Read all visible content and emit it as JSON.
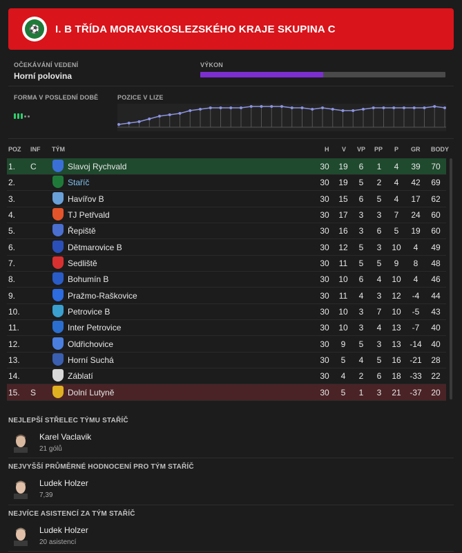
{
  "header": {
    "title": "I. B TŘÍDA MORAVSKOSLEZSKÉHO KRAJE SKUPINA C",
    "accent": "#d9141b"
  },
  "expectation": {
    "label": "Očekávání vedení",
    "value": "Horní polovina"
  },
  "performance": {
    "label": "Výkon",
    "level": 0.5,
    "color": "#7c2fd0"
  },
  "form": {
    "label": "Forma v poslední době",
    "bars": 3,
    "dots": 2,
    "color": "#2fcf6e"
  },
  "position_chart": {
    "label": "Pozice v lize",
    "chart_data": {
      "type": "line",
      "ylim": [
        15,
        1
      ],
      "values": [
        15,
        14,
        13,
        11,
        9,
        8,
        7,
        5,
        4,
        3,
        3,
        3,
        3,
        2,
        2,
        2,
        2,
        3,
        3,
        4,
        3,
        4,
        5,
        5,
        4,
        3,
        3,
        3,
        3,
        3,
        3,
        2,
        3
      ]
    }
  },
  "table": {
    "headers": {
      "pos": "POZ",
      "inf": "INF",
      "team": "TÝM",
      "h": "H",
      "v": "V",
      "vp": "VP",
      "pp": "PP",
      "p": "P",
      "gr": "GR",
      "body": "BODY"
    },
    "rows": [
      {
        "pos": "1.",
        "inf": "C",
        "team": "Slavoj Rychvald",
        "h": "30",
        "v": "19",
        "vp": "6",
        "pp": "1",
        "p": "4",
        "gr": "39",
        "body": "70",
        "color": "#3a6fd8",
        "status": "promo"
      },
      {
        "pos": "2.",
        "inf": "",
        "team": "Staříč",
        "h": "30",
        "v": "19",
        "vp": "5",
        "pp": "2",
        "p": "4",
        "gr": "42",
        "body": "69",
        "color": "#1f7a3a",
        "status": "self"
      },
      {
        "pos": "3.",
        "inf": "",
        "team": "Havířov B",
        "h": "30",
        "v": "15",
        "vp": "6",
        "pp": "5",
        "p": "4",
        "gr": "17",
        "body": "62",
        "color": "#6aa0d8",
        "status": ""
      },
      {
        "pos": "4.",
        "inf": "",
        "team": "TJ Petřvald",
        "h": "30",
        "v": "17",
        "vp": "3",
        "pp": "3",
        "p": "7",
        "gr": "24",
        "body": "60",
        "color": "#e3542a",
        "status": ""
      },
      {
        "pos": "5.",
        "inf": "",
        "team": "Řepiště",
        "h": "30",
        "v": "16",
        "vp": "3",
        "pp": "6",
        "p": "5",
        "gr": "19",
        "body": "60",
        "color": "#4a6fd0",
        "status": ""
      },
      {
        "pos": "6.",
        "inf": "",
        "team": "Dětmarovice B",
        "h": "30",
        "v": "12",
        "vp": "5",
        "pp": "3",
        "p": "10",
        "gr": "4",
        "body": "49",
        "color": "#2b4fb8",
        "status": ""
      },
      {
        "pos": "7.",
        "inf": "",
        "team": "Sedliště",
        "h": "30",
        "v": "11",
        "vp": "5",
        "pp": "5",
        "p": "9",
        "gr": "8",
        "body": "48",
        "color": "#d83030",
        "status": ""
      },
      {
        "pos": "8.",
        "inf": "",
        "team": "Bohumín B",
        "h": "30",
        "v": "10",
        "vp": "6",
        "pp": "4",
        "p": "10",
        "gr": "4",
        "body": "46",
        "color": "#2a5cc8",
        "status": ""
      },
      {
        "pos": "9.",
        "inf": "",
        "team": "Pražmo-Raškovice",
        "h": "30",
        "v": "11",
        "vp": "4",
        "pp": "3",
        "p": "12",
        "gr": "-4",
        "body": "44",
        "color": "#2c6be0",
        "status": ""
      },
      {
        "pos": "10.",
        "inf": "",
        "team": "Petrovice B",
        "h": "30",
        "v": "10",
        "vp": "3",
        "pp": "7",
        "p": "10",
        "gr": "-5",
        "body": "43",
        "color": "#3aa0d0",
        "status": ""
      },
      {
        "pos": "11.",
        "inf": "",
        "team": "Inter Petrovice",
        "h": "30",
        "v": "10",
        "vp": "3",
        "pp": "4",
        "p": "13",
        "gr": "-7",
        "body": "40",
        "color": "#2a6fd0",
        "status": ""
      },
      {
        "pos": "12.",
        "inf": "",
        "team": "Oldřichovice",
        "h": "30",
        "v": "9",
        "vp": "5",
        "pp": "3",
        "p": "13",
        "gr": "-14",
        "body": "40",
        "color": "#4a7fe0",
        "status": ""
      },
      {
        "pos": "13.",
        "inf": "",
        "team": "Horní Suchá",
        "h": "30",
        "v": "5",
        "vp": "4",
        "pp": "5",
        "p": "16",
        "gr": "-21",
        "body": "28",
        "color": "#3a5fb0",
        "status": ""
      },
      {
        "pos": "14.",
        "inf": "",
        "team": "Záblatí",
        "h": "30",
        "v": "4",
        "vp": "2",
        "pp": "6",
        "p": "18",
        "gr": "-33",
        "body": "22",
        "color": "#d8d8d8",
        "status": ""
      },
      {
        "pos": "15.",
        "inf": "S",
        "team": "Dolní Lutyně",
        "h": "30",
        "v": "5",
        "vp": "1",
        "pp": "3",
        "p": "21",
        "gr": "-37",
        "body": "20",
        "color": "#e0b020",
        "status": "releg"
      }
    ]
  },
  "top_scorer": {
    "title": "Nejlepší střelec týmu Staříč",
    "name": "Karel Vaclavik",
    "stat": "21 gólů"
  },
  "top_rating": {
    "title": "Nejvyšší průměrné hodnocení pro tým Staříč",
    "name": "Ludek Holzer",
    "stat": "7,39"
  },
  "top_assists": {
    "title": "Nejvíce asistencí za tým Staříč",
    "name": "Ludek Holzer",
    "stat": "20 asistencí"
  }
}
